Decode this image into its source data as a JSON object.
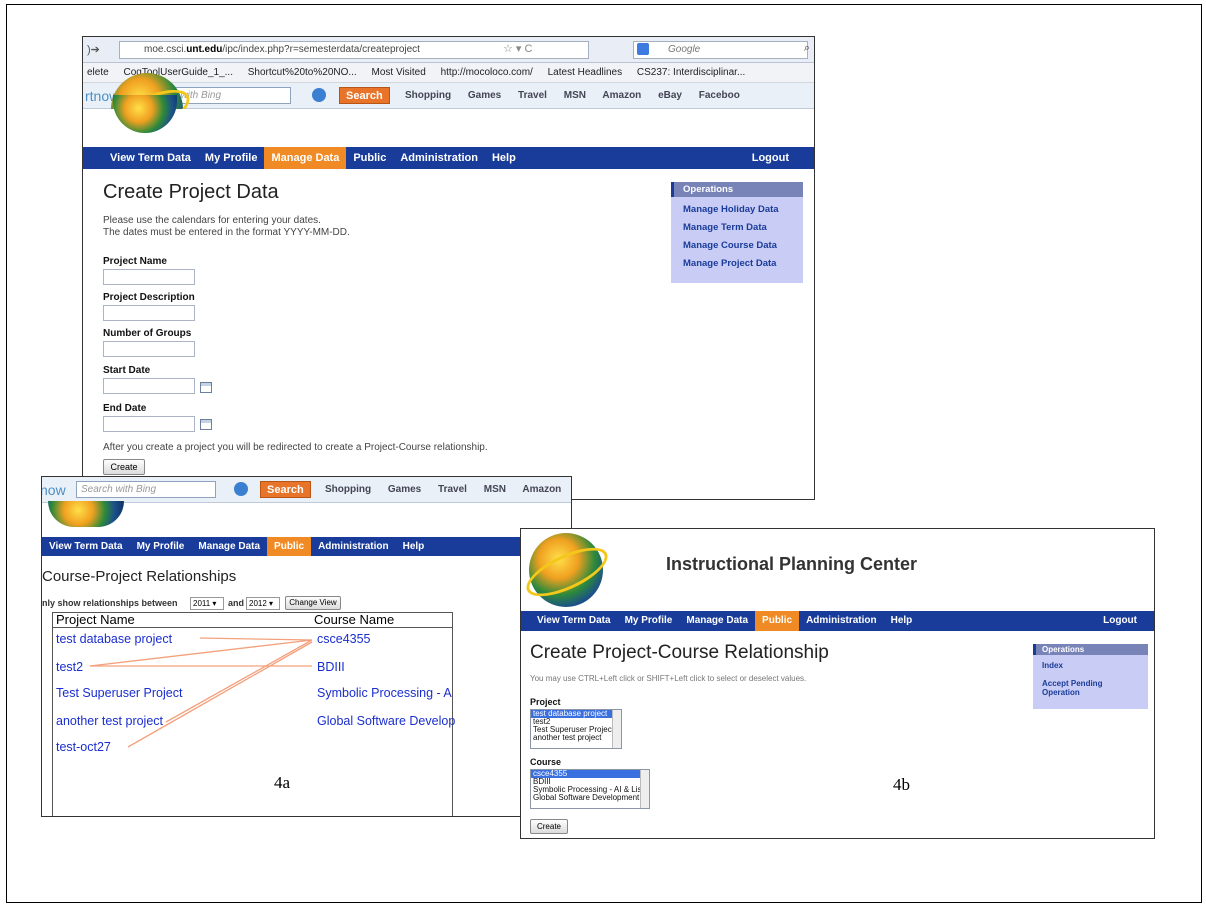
{
  "shotA": {
    "url_prefix": "moe.csci.",
    "url_domain": "unt.edu",
    "url_path": "/ipc/index.php?r=semesterdata/createproject",
    "search_engine": "Google",
    "bookmarks": [
      "elete",
      "CogToolUserGuide_1_...",
      "Shortcut%20to%20NO...",
      "Most Visited",
      "http://mocoloco.com/",
      "Latest Headlines",
      "CS237: Interdisciplinar..."
    ],
    "bing_logo": "rtnow",
    "bing_placeholder": "Search with Bing",
    "bing_search": "Search",
    "bing_links": [
      "Shopping",
      "Games",
      "Travel",
      "MSN",
      "Amazon",
      "eBay",
      "Faceboo"
    ],
    "menu": [
      "View Term Data",
      "My Profile",
      "Manage Data",
      "Public",
      "Administration",
      "Help"
    ],
    "logout": "Logout",
    "title": "Create Project Data",
    "intro1": "Please use the calendars for entering your dates.",
    "intro2": "The dates must be entered in the format YYYY-MM-DD.",
    "fields": [
      "Project Name",
      "Project Description",
      "Number of Groups",
      "Start Date",
      "End Date"
    ],
    "note": "After you create a project you will be redirected to create a Project-Course relationship.",
    "create": "Create",
    "ops_head": "Operations",
    "ops": [
      "Manage Holiday Data",
      "Manage Term Data",
      "Manage Course Data",
      "Manage Project Data"
    ]
  },
  "shotB": {
    "bing_logo": "now",
    "bing_placeholder": "Search with Bing",
    "bing_search": "Search",
    "bing_links": [
      "Shopping",
      "Games",
      "Travel",
      "MSN",
      "Amazon"
    ],
    "menu": [
      "View Term Data",
      "My Profile",
      "Manage Data",
      "Public",
      "Administration",
      "Help"
    ],
    "title": "Course-Project Relationships",
    "filter_label": "nly show relationships between",
    "year_from": "2011",
    "and": "and",
    "year_to": "2012",
    "change_view": "Change View",
    "col_project": "Project Name",
    "col_course": "Course Name",
    "projects": [
      "test database project",
      "test2",
      "Test Superuser Project",
      "another test project",
      "test-oct27"
    ],
    "courses": [
      "csce4355",
      "BDIII",
      "Symbolic Processing - A",
      "Global Software Develop"
    ],
    "caption": "4a"
  },
  "shotC": {
    "header": "Instructional Planning Center",
    "menu": [
      "View Term Data",
      "My Profile",
      "Manage Data",
      "Public",
      "Administration",
      "Help"
    ],
    "logout": "Logout",
    "title": "Create Project-Course Relationship",
    "hint": "You may use CTRL+Left click or SHIFT+Left click to select or deselect values.",
    "project_label": "Project",
    "projects": [
      "test database project",
      "test2",
      "Test Superuser Project",
      "another test project"
    ],
    "course_label": "Course",
    "courses": [
      "csce4355",
      "BDIII",
      "Symbolic Processing - AI & Lisp",
      "Global Software Development"
    ],
    "create": "Create",
    "ops_head": "Operations",
    "ops": [
      "Index",
      "Accept Pending",
      "Operation"
    ],
    "caption": "4b"
  },
  "colors": {
    "menu_bg": "#193c9a",
    "menu_active": "#f08a24",
    "ops_bg": "#c9ccf4",
    "link": "#1a2ecf",
    "relation_line": "#f4a07c"
  }
}
